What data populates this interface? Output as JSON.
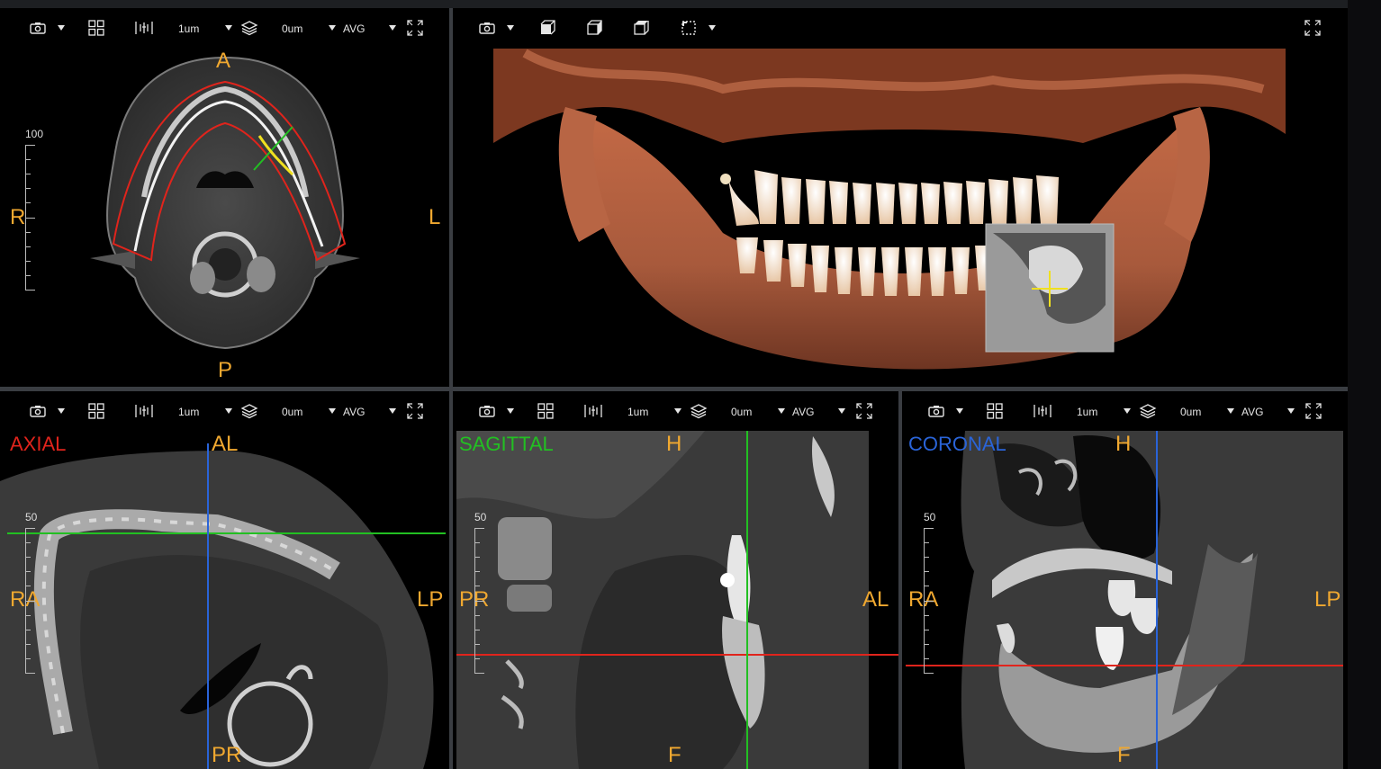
{
  "toolbar": {
    "thickness": "1um",
    "offset": "0um",
    "mode": "AVG"
  },
  "axial_top": {
    "orient_top": "A",
    "orient_bottom": "P",
    "orient_left": "R",
    "orient_right": "L",
    "ruler_label": "100"
  },
  "axial": {
    "title": "AXIAL",
    "orient_top": "AL",
    "orient_bottom": "PR",
    "orient_left": "RA",
    "orient_right": "LP",
    "ruler_label": "50"
  },
  "sagittal": {
    "title": "SAGITTAL",
    "orient_top": "H",
    "orient_bottom": "F",
    "orient_left": "PR",
    "orient_right": "AL",
    "ruler_label": "50"
  },
  "coronal": {
    "title": "CORONAL",
    "orient_top": "H",
    "orient_bottom": "F",
    "orient_left": "RA",
    "orient_right": "LP",
    "ruler_label": "50"
  },
  "colors": {
    "accent_orange": "#f0a830",
    "axial_red": "#e0241c",
    "sagittal_green": "#22c022",
    "coronal_blue": "#2a64d8",
    "crosshair_yellow": "#f0e020"
  },
  "icons": [
    "camera-icon",
    "grid-layout-icon",
    "slab-thickness-icon",
    "layers-icon",
    "fullscreen-icon",
    "cube-front-icon",
    "cube-side-icon",
    "cube-top-icon",
    "crop-box-icon"
  ]
}
